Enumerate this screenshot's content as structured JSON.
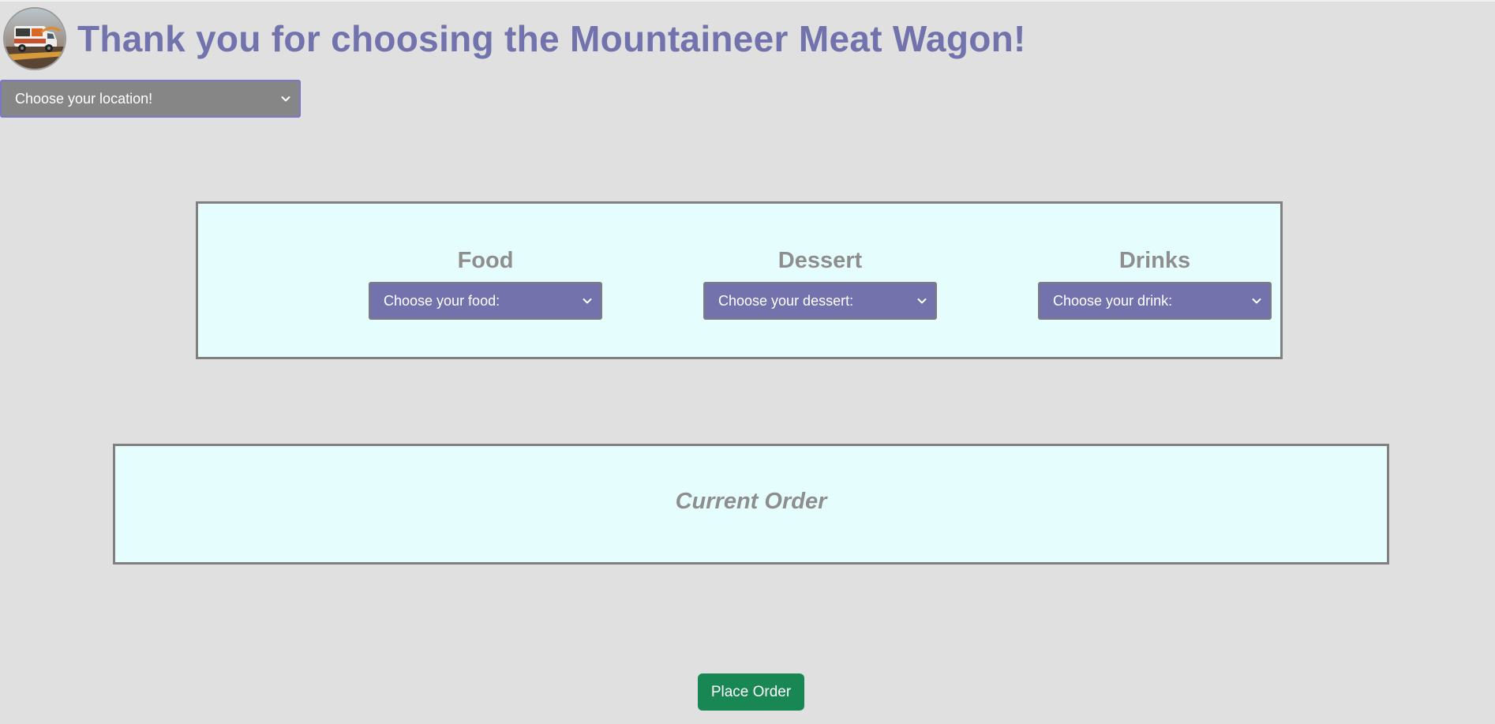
{
  "header": {
    "title": "Thank you for choosing the Mountaineer Meat Wagon!",
    "logo_icon": "food-truck-logo"
  },
  "location": {
    "selected": "Choose your location!"
  },
  "menu": {
    "food": {
      "heading": "Food",
      "selected": "Choose your food:"
    },
    "dessert": {
      "heading": "Dessert",
      "selected": "Choose your dessert:"
    },
    "drinks": {
      "heading": "Drinks",
      "selected": "Choose your drink:"
    }
  },
  "order": {
    "heading": "Current Order"
  },
  "actions": {
    "place_order_label": "Place Order"
  },
  "colors": {
    "accent": "#7372ad",
    "background": "#e0e0e0",
    "panel": "#e6fdfd",
    "button": "#198754"
  }
}
